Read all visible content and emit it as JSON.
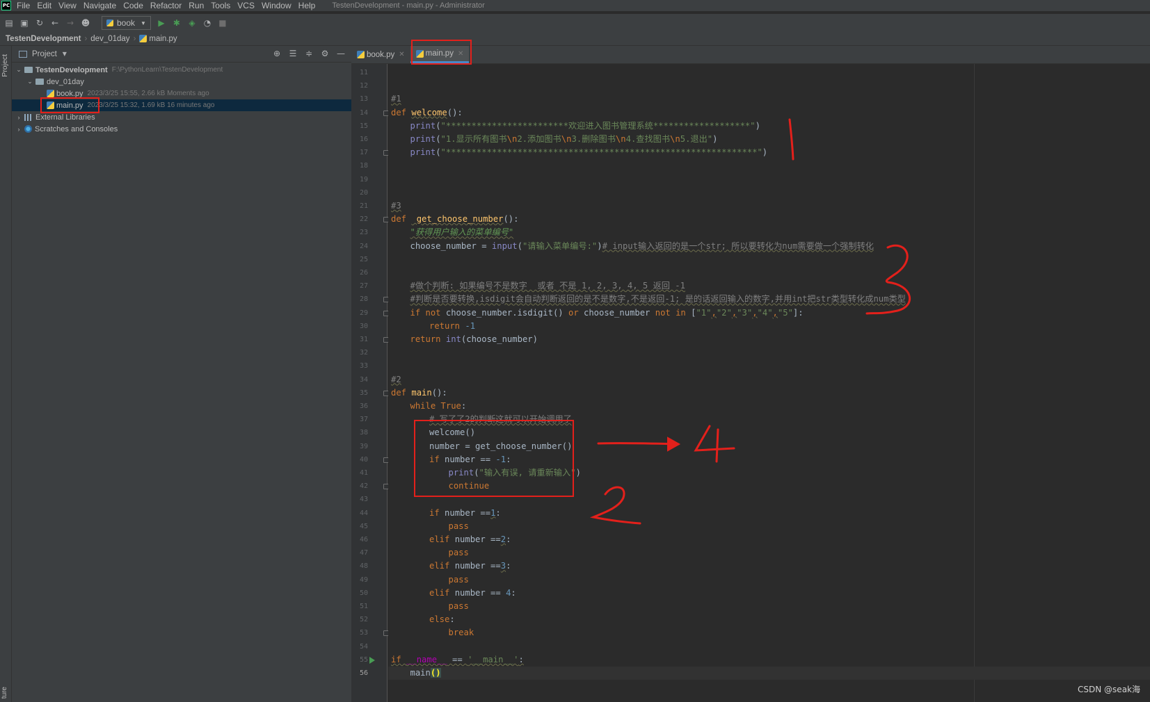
{
  "app": {
    "logo": "PC",
    "window_title": "TestenDevelopment - main.py - Administrator"
  },
  "menu": [
    "File",
    "Edit",
    "View",
    "Navigate",
    "Code",
    "Refactor",
    "Run",
    "Tools",
    "VCS",
    "Window",
    "Help"
  ],
  "toolbar": {
    "run_config": "book"
  },
  "breadcrumb": [
    "TestenDevelopment",
    "dev_01day",
    "main.py"
  ],
  "stripe": {
    "project": "Project",
    "structure": "ture"
  },
  "project_panel": {
    "title": "Project",
    "tree": [
      {
        "label": "TestenDevelopment",
        "meta": "F:\\PythonLearn\\TestenDevelopment"
      },
      {
        "label": "dev_01day",
        "meta": ""
      },
      {
        "label": "book.py",
        "meta": "2023/3/25 15:55, 2.66 kB Moments ago"
      },
      {
        "label": "main.py",
        "meta": "2023/3/25 15:32, 1.69 kB 16 minutes ago"
      },
      {
        "label": "External Libraries",
        "meta": ""
      },
      {
        "label": "Scratches and Consoles",
        "meta": ""
      }
    ]
  },
  "tabs": [
    {
      "label": "book.py",
      "active": false
    },
    {
      "label": "main.py",
      "active": true
    }
  ],
  "editor": {
    "line_numbers": [
      "11",
      "12",
      "13",
      "14",
      "15",
      "16",
      "17",
      "18",
      "19",
      "20",
      "21",
      "22",
      "23",
      "24",
      "25",
      "26",
      "27",
      "28",
      "29",
      "30",
      "31",
      "32",
      "33",
      "34",
      "35",
      "36",
      "37",
      "38",
      "39",
      "40",
      "41",
      "42",
      "43",
      "44",
      "45",
      "46",
      "47",
      "48",
      "49",
      "50",
      "51",
      "52",
      "53",
      "54",
      "55",
      "56"
    ],
    "code_text": {
      "c13": "#1",
      "c14_def": "def ",
      "c14_name": "welcome",
      "c14_tail": "():",
      "c15_print": "print",
      "c15_str": "\"************************欢迎进入图书管理系统*******************\"",
      "c16_print": "print",
      "c16_s1": "\"1.显示所有图书",
      "c16_e1": "\\n",
      "c16_s2": "2.添加图书",
      "c16_e2": "\\n",
      "c16_s3": "3.删除图书",
      "c16_e3": "\\n",
      "c16_s4": "4.查找图书",
      "c16_e4": "\\n",
      "c16_s5": "5.退出\"",
      "c17_print": "print",
      "c17_str": "\"*************************************************************\"",
      "c21": "#3",
      "c22_def": "def ",
      "c22_name": " get_choose_number",
      "c22_tail": "():",
      "c23_doc": "\"获得用户输入的菜单编号\"",
      "c24_var": "choose_number = ",
      "c24_input": "input",
      "c24_str": "\"请输入菜单编号:\"",
      "c24_paren": ")",
      "c24_cmt": "# input输入返回的是一个str; 所以要转化为num需要做一个强制转化",
      "c27_cmt": "#做个判断: 如果编号不是数字  或者 不是 1, 2, 3, 4, 5 返回 -1",
      "c28_cmt": "#判断是否要转换,isdigit会自动判断返回的是不是数字,不是返回-1; 是的话返回输入的数字,并用int把str类型转化成num类型",
      "c29_if": "if not ",
      "c29_a": "choose_number.isdigit() ",
      "c29_or": "or ",
      "c29_b": "choose_number ",
      "c29_notin": "not in ",
      "c29_lb": "[",
      "c29_s1": "\"1\"",
      "c29_s2": "\"2\"",
      "c29_s3": "\"3\"",
      "c29_s4": "\"4\"",
      "c29_s5": "\"5\"",
      "c29_comma": ",",
      "c29_rb": "]:",
      "c30_ret": "return ",
      "c30_num": "-1",
      "c31_ret": "return ",
      "c31_int": "int",
      "c31_tail": "(choose_number)",
      "c34": "#2",
      "c35_def": "def ",
      "c35_name": "main",
      "c35_tail": "():",
      "c36_while": "while ",
      "c36_true": "True",
      "c36_colon": ":",
      "c37_cmt": "# 写了了2的判断这就可以开始调用了",
      "c38": "welcome()",
      "c39": "number = get_choose_number()",
      "c40_if": "if ",
      "c40_var": "number == ",
      "c40_num": "-1",
      "c40_colon": ":",
      "c41_print": "print",
      "c41_str": "\"输入有误, 请重新输入\"",
      "c41_paren": ")",
      "c42": "continue",
      "c44_if": "if ",
      "c44_var": "number ==",
      "c44_num": "1",
      "c44_colon": ":",
      "c45": "pass",
      "c46_elif": "elif ",
      "c46_var": "number ==",
      "c46_num": "2",
      "c46_colon": ":",
      "c47": "pass",
      "c48_elif": "elif ",
      "c48_var": "number ==",
      "c48_num": "3",
      "c48_colon": ":",
      "c49": "pass",
      "c50_elif": "elif ",
      "c50_var": "number == ",
      "c50_num": "4",
      "c50_colon": ":",
      "c51": "pass",
      "c52_else": "else",
      "c52_colon": ":",
      "c53": "break",
      "c55_if": "if ",
      "c55_name": "__name__",
      "c55_eq": " == ",
      "c55_str": "'__main__'",
      "c55_colon": ":",
      "c56_main": "main",
      "c56_paren": "()"
    }
  },
  "annotations": {
    "color": "#e3201b",
    "labels": [
      "1",
      "3",
      "4",
      "2"
    ]
  },
  "watermark": "CSDN @seak海",
  "colors": {
    "keyword": "#cc7832",
    "function": "#ffc66d",
    "string": "#6a8759",
    "number": "#6897bb",
    "comment": "#808080",
    "selection": "#0d293e",
    "tab_underline": "#4a88c7"
  }
}
